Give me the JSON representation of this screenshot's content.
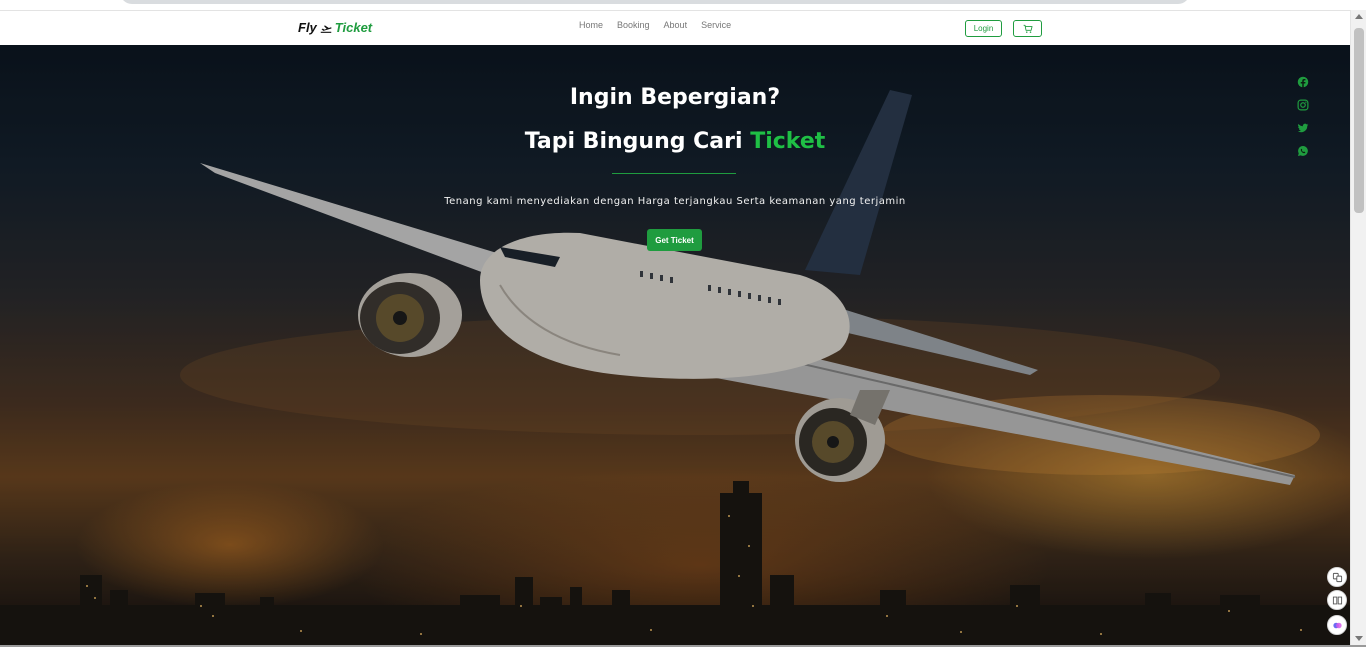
{
  "brand": {
    "part1": "Fly",
    "icon": "plane-departure-icon",
    "part2": "Ticket"
  },
  "nav": {
    "links": [
      "Home",
      "Booking",
      "About",
      "Service"
    ],
    "login_label": "Login",
    "cart_icon": "cart-icon"
  },
  "hero": {
    "headline_line1": "Ingin Bepergian?",
    "headline_line2_prefix": "Tapi Bingung Cari",
    "headline_line2_accent": "Ticket",
    "tagline": "Tenang kami menyediakan dengan Harga terjangkau Serta keamanan yang terjamin",
    "cta_label": "Get Ticket"
  },
  "socials": [
    "facebook-icon",
    "instagram-icon",
    "twitter-icon",
    "whatsapp-icon"
  ],
  "colors": {
    "accent": "#1f9c3f",
    "accent_bright": "#1fbf45",
    "text_light": "#ffffff"
  }
}
